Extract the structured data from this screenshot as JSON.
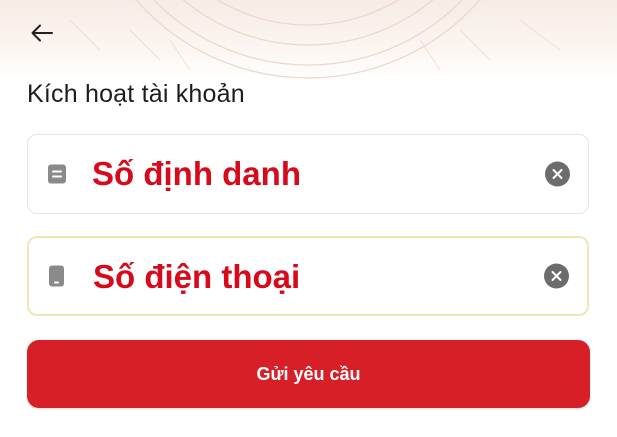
{
  "header": {
    "back_icon": "arrow-left-icon"
  },
  "page": {
    "title": "Kích hoạt tài khoản"
  },
  "form": {
    "id_field": {
      "icon": "id-card-icon",
      "placeholder": "Số định danh",
      "value": "",
      "clear_icon": "clear-icon"
    },
    "phone_field": {
      "icon": "phone-icon",
      "placeholder": "Số điện thoại",
      "value": "",
      "clear_icon": "clear-icon"
    },
    "submit_label": "Gửi yêu cầu"
  },
  "colors": {
    "accent": "#d61f26",
    "placeholder_text": "#d8091b",
    "focused_border": "#eee6b5"
  }
}
